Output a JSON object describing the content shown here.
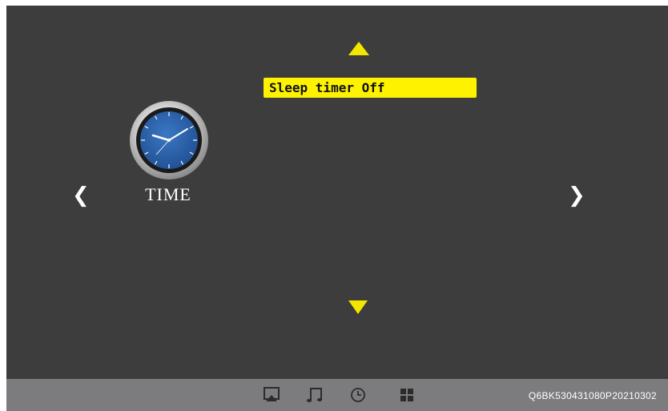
{
  "menu": {
    "current_item": "Sleep timer Off"
  },
  "category": {
    "label": "TIME",
    "icon": "clock-icon"
  },
  "navigation": {
    "left_glyph": "❮",
    "right_glyph": "❯",
    "up_icon": "arrow-up-icon",
    "down_icon": "arrow-down-icon"
  },
  "taskbar": {
    "icons": [
      "picture-icon",
      "music-icon",
      "clock-icon",
      "apps-grid-icon"
    ],
    "version_text": "Q6BK530431080P20210302"
  },
  "colors": {
    "screen_bg": "#3d3d3d",
    "taskbar_bg": "#7c7c7e",
    "highlight": "#fff200",
    "clock_face": "#2a5fa8"
  }
}
